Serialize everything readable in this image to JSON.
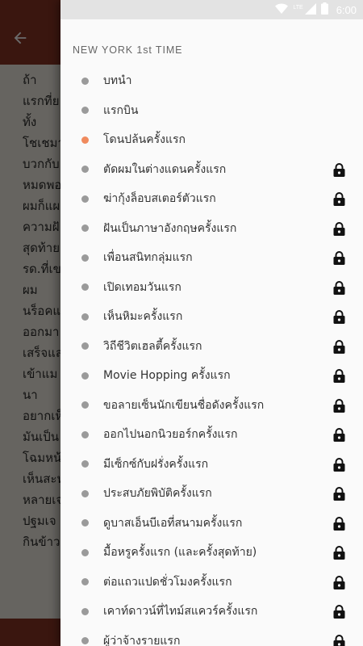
{
  "status_bar": {
    "time": "6:00",
    "network_label": "LTE",
    "icons": [
      "wifi-icon",
      "cellular-icon",
      "battery-icon"
    ]
  },
  "reader": {
    "back_icon": "arrow-left-icon",
    "paragraphs": [
      "ถ้า",
      "แรกที่ย",
      "ทั้ง",
      "โชเชมา",
      "บวกกับ",
      "หมดพอ",
      "ผมก็แผ",
      "ความฝั",
      "สุดท้าย",
      "รด.ที่เข",
      "ผม",
      "นร็อคแ",
      "ออกมา",
      "เสร็จแล",
      "เข้าแม",
      "นา",
      "อยากเห็",
      "มันเป็น",
      "โฉมหน้",
      "เห็นสะห",
      "หลายเจ",
      "ปฐมเจ",
      "กินข้าว"
    ]
  },
  "drawer": {
    "header": "NEW YORK 1st TIME",
    "accent_color": "#f08a5d",
    "items": [
      {
        "label": "บทนำ",
        "locked": false,
        "active": false
      },
      {
        "label": "แรกบิน",
        "locked": false,
        "active": false
      },
      {
        "label": "โดนปล้นครั้งแรก",
        "locked": false,
        "active": true
      },
      {
        "label": "ตัดผมในต่างแดนครั้งแรก",
        "locked": true,
        "active": false
      },
      {
        "label": "ฆ่ากุ้งล็อบสเตอร์ตัวแรก",
        "locked": true,
        "active": false
      },
      {
        "label": "ฝันเป็นภาษาอังกฤษครั้งแรก",
        "locked": true,
        "active": false
      },
      {
        "label": "เพื่อนสนิทกลุ่มแรก",
        "locked": true,
        "active": false
      },
      {
        "label": "เปิดเทอมวันแรก",
        "locked": true,
        "active": false
      },
      {
        "label": "เห็นหิมะครั้งแรก",
        "locked": true,
        "active": false
      },
      {
        "label": "วิถีชีวิตเฮลตี้ครั้งแรก",
        "locked": true,
        "active": false
      },
      {
        "label": "Movie Hopping ครั้งแรก",
        "locked": true,
        "active": false
      },
      {
        "label": "ขอลายเซ็นนักเขียนชื่อดังครั้งแรก",
        "locked": true,
        "active": false
      },
      {
        "label": "ออกไปนอกนิวยอร์กครั้งแรก",
        "locked": true,
        "active": false
      },
      {
        "label": "มีเซ็กซ์กับฝรั่งครั้งแรก",
        "locked": true,
        "active": false
      },
      {
        "label": "ประสบภัยพิบัติครั้งแรก",
        "locked": true,
        "active": false
      },
      {
        "label": "ดูบาสเอ็นบีเอที่สนามครั้งแรก",
        "locked": true,
        "active": false
      },
      {
        "label": "มื้อหรูครั้งแรก (และครั้งสุดท้าย)",
        "locked": true,
        "active": false
      },
      {
        "label": "ต่อแถวแปดชั่วโมงครั้งแรก",
        "locked": true,
        "active": false
      },
      {
        "label": "เคาท์ดาวน์ที่ไทม์สแควร์ครั้งแรก",
        "locked": true,
        "active": false
      },
      {
        "label": "ผู้ว่าจ้างรายแรก",
        "locked": true,
        "active": false
      }
    ]
  }
}
